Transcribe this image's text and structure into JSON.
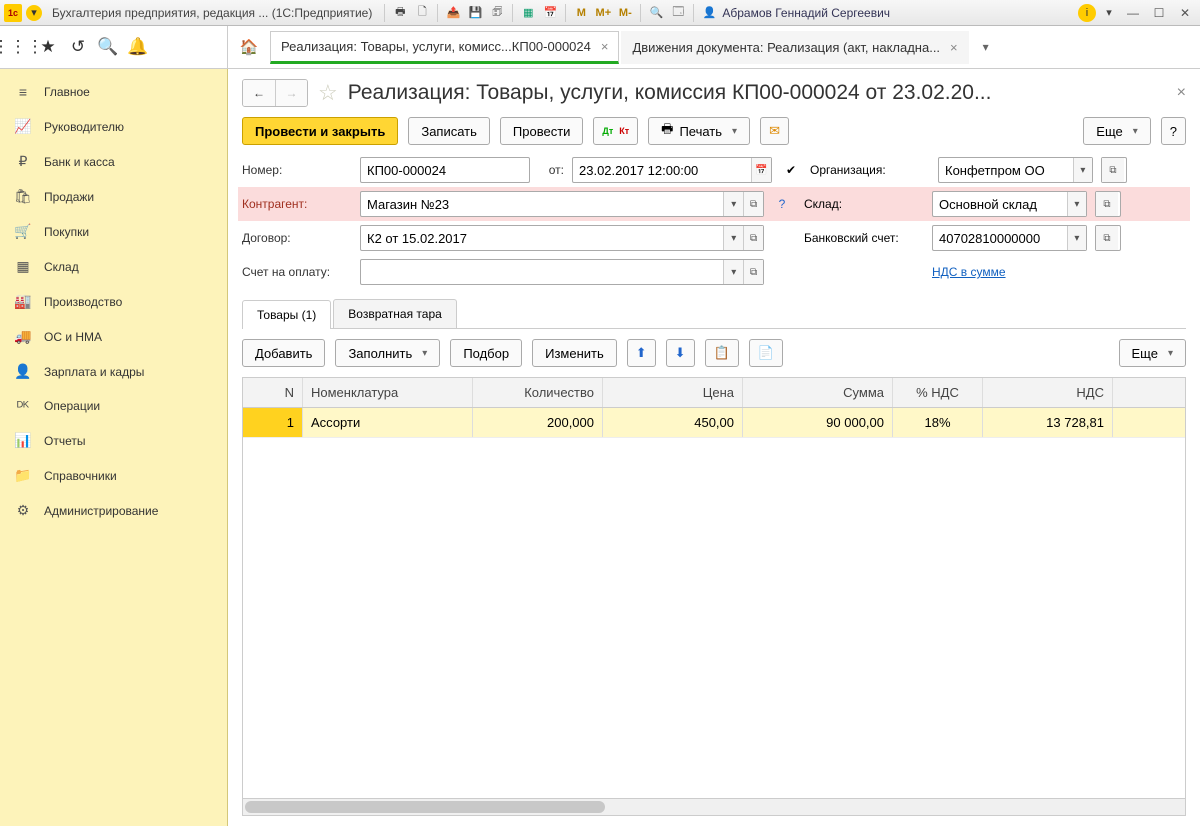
{
  "titlebar": {
    "app_title": "Бухгалтерия предприятия, редакция ... (1С:Предприятие)",
    "user": "Абрамов Геннадий Сергеевич",
    "m_buttons": [
      "M",
      "M+",
      "M-"
    ]
  },
  "toptabs": {
    "tab1": "Реализация: Товары, услуги, комисс...КП00-000024",
    "tab2": "Движения документа: Реализация (акт, накладна..."
  },
  "sidenav": [
    {
      "icon": "≡",
      "label": "Главное"
    },
    {
      "icon": "📈",
      "label": "Руководителю"
    },
    {
      "icon": "₽",
      "label": "Банк и касса"
    },
    {
      "icon": "🛍",
      "label": "Продажи"
    },
    {
      "icon": "🛒",
      "label": "Покупки"
    },
    {
      "icon": "▦",
      "label": "Склад"
    },
    {
      "icon": "🏭",
      "label": "Производство"
    },
    {
      "icon": "🚚",
      "label": "ОС и НМА"
    },
    {
      "icon": "👤",
      "label": "Зарплата и кадры"
    },
    {
      "icon": "ᴰᴷ",
      "label": "Операции"
    },
    {
      "icon": "📊",
      "label": "Отчеты"
    },
    {
      "icon": "📁",
      "label": "Справочники"
    },
    {
      "icon": "⚙",
      "label": "Администрирование"
    }
  ],
  "page": {
    "title": "Реализация: Товары, услуги, комиссия КП00-000024 от 23.02.20...",
    "cmd": {
      "post_close": "Провести и закрыть",
      "save": "Записать",
      "post": "Провести",
      "print": "Печать",
      "more": "Еще",
      "help": "?"
    },
    "form": {
      "number_label": "Номер:",
      "number": "КП00-000024",
      "date_label": "от:",
      "date": "23.02.2017 12:00:00",
      "org_label": "Организация:",
      "org": "Конфетпром ОО",
      "contr_label": "Контрагент:",
      "contr": "Магазин №23",
      "wh_label": "Склад:",
      "wh": "Основной склад",
      "dogovor_label": "Договор:",
      "dogovor": "К2 от 15.02.2017",
      "bank_label": "Банковский счет:",
      "bank": "40702810000000",
      "invoice_label": "Счет на оплату:",
      "invoice": "",
      "vat_link": "НДС в сумме"
    },
    "subtabs": {
      "goods": "Товары (1)",
      "tare": "Возвратная тара"
    },
    "tbl": {
      "cmd": {
        "add": "Добавить",
        "fill": "Заполнить",
        "select": "Подбор",
        "edit": "Изменить",
        "more": "Еще"
      },
      "headers": {
        "n": "N",
        "nom": "Номенклатура",
        "qty": "Количество",
        "price": "Цена",
        "sum": "Сумма",
        "vatp": "% НДС",
        "vat": "НДС"
      },
      "rows": [
        {
          "n": "1",
          "nom": "Ассорти",
          "qty": "200,000",
          "price": "450,00",
          "sum": "90 000,00",
          "vatp": "18%",
          "vat": "13 728,81"
        }
      ]
    }
  }
}
